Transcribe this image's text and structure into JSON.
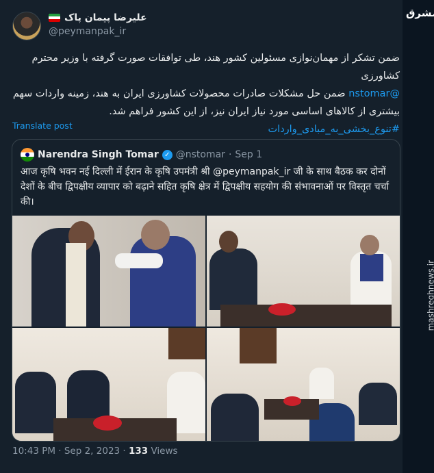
{
  "author": {
    "display_name": "علیرضا پیمان پاک",
    "handle": "@peymanpak_ir"
  },
  "tweet": {
    "line1": "ضمن تشکر از مهمان‌نوازی مسئولین کشور هند، طی توافقات صورت گرفته با وزیر محترم کشاورزی",
    "line2_mention": "@nstomar",
    "line2_rest": " ضمن حل مشکلات صادرات محصولات کشاورزی ایران به هند، زمینه واردات سهم",
    "line3": "بیشتری از کالاهای اساسی مورد نیاز ایران نیز، از این کشور فراهم شد.",
    "hashtag": "#تنوع_بخشی_به_مبادی_واردات"
  },
  "translate_label": "Translate post",
  "quote": {
    "name": "Narendra Singh Tomar",
    "verified_icon": "✓",
    "handle": "@nstomar",
    "separator": "·",
    "date": "Sep 1",
    "text": "आज कृषि भवन नई दिल्ली में ईरान के कृषि उपमंत्री श्री @peymanpak_ir जी के साथ बैठक कर दोनों देशों के बीच द्विपक्षीय व्यापार को बढ़ाने सहित कृषि क्षेत्र में द्विपक्षीय सहयोग की संभावनाओं पर विस्तृत चर्चा की।"
  },
  "meta": {
    "time_date": "10:43 PM · Sep 2, 2023 · ",
    "views_count": "133",
    "views_label": " Views"
  },
  "watermark": {
    "logo": "مشرق",
    "url": "mashreghnews.ir"
  },
  "colors": {
    "background": "#15202b",
    "accent": "#1d9bf0",
    "muted": "#8b98a5",
    "border": "#38444d"
  }
}
